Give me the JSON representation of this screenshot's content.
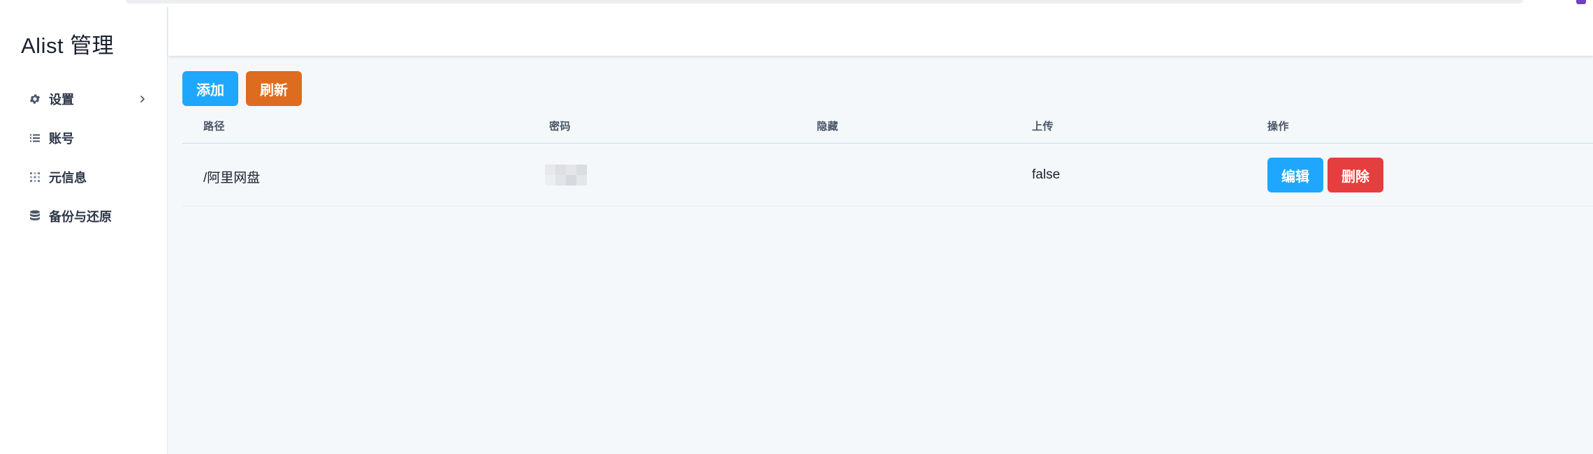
{
  "sidebar": {
    "brand": "Alist 管理",
    "items": [
      {
        "label": "设置",
        "icon": "gear-icon",
        "has_submenu": true
      },
      {
        "label": "账号",
        "icon": "list-icon"
      },
      {
        "label": "元信息",
        "icon": "grid-icon"
      },
      {
        "label": "备份与还原",
        "icon": "database-icon"
      }
    ]
  },
  "toolbar": {
    "add_label": "添加",
    "refresh_label": "刷新"
  },
  "table": {
    "headers": [
      "路径",
      "密码",
      "隐藏",
      "上传",
      "操作"
    ],
    "rows": [
      {
        "path": "/阿里网盘",
        "password": "",
        "hidden": "",
        "upload": "false",
        "edit_label": "编辑",
        "delete_label": "删除"
      }
    ]
  },
  "colors": {
    "primary": "#1ea7fd",
    "warning": "#dd6b20",
    "danger": "#e53e3e",
    "background": "#f5f8fb",
    "extension_accent": "#6f42c1"
  }
}
